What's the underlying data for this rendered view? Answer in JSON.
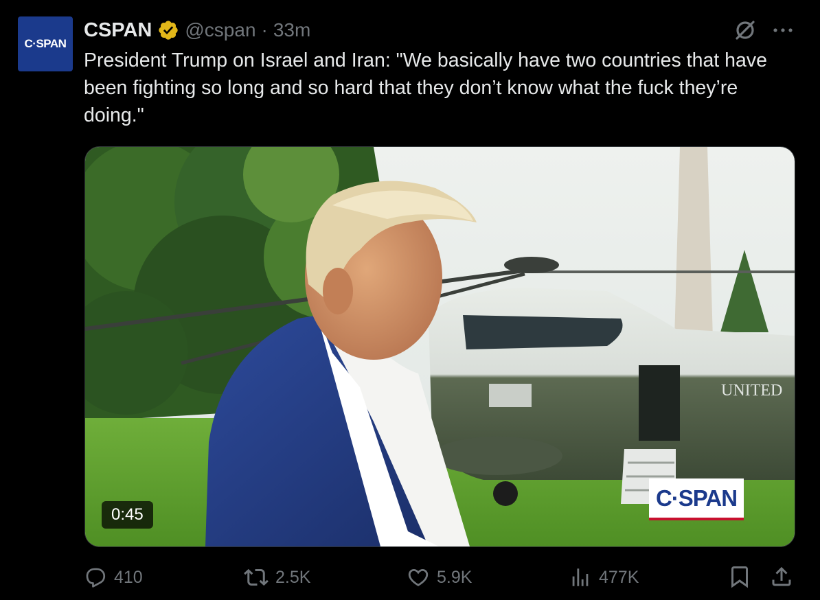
{
  "author": {
    "avatar_text": "C·SPAN",
    "display_name": "CSPAN",
    "handle": "@cspan",
    "separator": "·",
    "timestamp": "33m"
  },
  "post": {
    "text": "President Trump on Israel and Iran: \"We basically have two countries that have been fighting so long and so hard that they don’t know what the fuck they’re doing.\""
  },
  "media": {
    "duration": "0:45",
    "watermark": "C·SPAN",
    "helicopter_lettering": "UNITED"
  },
  "actions": {
    "replies": "410",
    "reposts": "2.5K",
    "likes": "5.9K",
    "views": "477K"
  },
  "icons": {
    "verified": "gold-check-badge-icon",
    "grok": "grok-icon",
    "more": "more-dots-icon",
    "reply": "reply-icon",
    "repost": "repost-icon",
    "like": "heart-icon",
    "views": "views-chart-icon",
    "bookmark": "bookmark-icon",
    "share": "share-icon"
  },
  "colors": {
    "background": "#000000",
    "text_primary": "#e7e9ea",
    "text_secondary": "#71767b",
    "verified_gold": "#e2b719",
    "cspan_blue": "#1b3a8c"
  }
}
